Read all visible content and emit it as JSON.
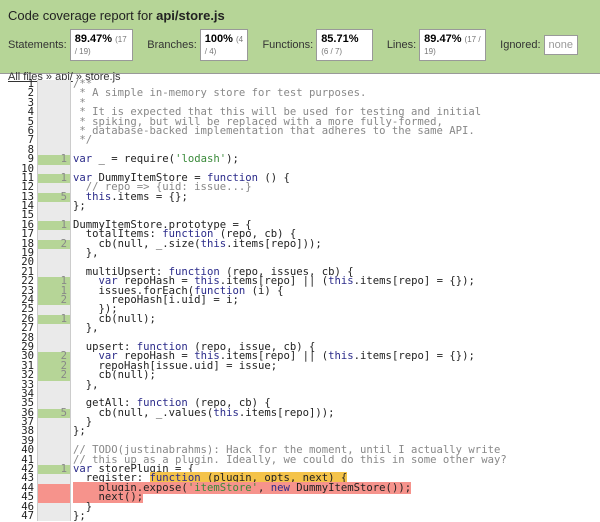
{
  "header": {
    "title_prefix": "Code coverage report for ",
    "title_file": "api/store.js",
    "stats": [
      {
        "label": "Statements:",
        "pct": "89.47%",
        "frac": "(17 / 19)"
      },
      {
        "label": "Branches:",
        "pct": "100%",
        "frac": "(4 / 4)"
      },
      {
        "label": "Functions:",
        "pct": "85.71%",
        "frac": "(6 / 7)"
      },
      {
        "label": "Lines:",
        "pct": "89.47%",
        "frac": "(17 / 19)"
      }
    ],
    "ignored_label": "Ignored:",
    "ignored_value": "none",
    "breadcrumb": {
      "all_files": "All files",
      "sep1": " » ",
      "dir": "api/",
      "sep2": " » ",
      "file": "store.js"
    }
  },
  "colors": {
    "covered": "#b6d597",
    "uncovered": "#f6938c",
    "uncovered_function": "#f4c34a"
  },
  "lines": [
    {
      "n": "1",
      "c": "",
      "s": "",
      "t": "/**"
    },
    {
      "n": "2",
      "c": "",
      "s": "",
      "t": " * A simple in-memory store for test purposes."
    },
    {
      "n": "3",
      "c": "",
      "s": "",
      "t": " *"
    },
    {
      "n": "4",
      "c": "",
      "s": "",
      "t": " * It is expected that this will be used for testing and initial"
    },
    {
      "n": "5",
      "c": "",
      "s": "",
      "t": " * spiking, but will be replaced with a more fully-formed,"
    },
    {
      "n": "6",
      "c": "",
      "s": "",
      "t": " * database-backed implementation that adheres to the same API."
    },
    {
      "n": "7",
      "c": "",
      "s": "",
      "t": " */"
    },
    {
      "n": "8",
      "c": "",
      "s": "",
      "t": ""
    },
    {
      "n": "9",
      "c": "1",
      "s": "yes",
      "t": "var _ = require('lodash');"
    },
    {
      "n": "10",
      "c": "",
      "s": "",
      "t": ""
    },
    {
      "n": "11",
      "c": "1",
      "s": "yes",
      "t": "var DummyItemStore = function () {"
    },
    {
      "n": "12",
      "c": "",
      "s": "",
      "t": "  // repo => {uid: issue...}"
    },
    {
      "n": "13",
      "c": "5",
      "s": "yes",
      "t": "  this.items = {};"
    },
    {
      "n": "14",
      "c": "",
      "s": "",
      "t": "};"
    },
    {
      "n": "15",
      "c": "",
      "s": "",
      "t": ""
    },
    {
      "n": "16",
      "c": "1",
      "s": "yes",
      "t": "DummyItemStore.prototype = {"
    },
    {
      "n": "17",
      "c": "",
      "s": "",
      "t": "  totalItems: function (repo, cb) {"
    },
    {
      "n": "18",
      "c": "2",
      "s": "yes",
      "t": "    cb(null, _.size(this.items[repo]));"
    },
    {
      "n": "19",
      "c": "",
      "s": "",
      "t": "  },"
    },
    {
      "n": "20",
      "c": "",
      "s": "",
      "t": ""
    },
    {
      "n": "21",
      "c": "",
      "s": "",
      "t": "  multiUpsert: function (repo, issues, cb) {"
    },
    {
      "n": "22",
      "c": "1",
      "s": "yes",
      "t": "    var repoHash = this.items[repo] || (this.items[repo] = {});"
    },
    {
      "n": "23",
      "c": "1",
      "s": "yes",
      "t": "    issues.forEach(function (i) {"
    },
    {
      "n": "24",
      "c": "2",
      "s": "yes",
      "t": "      repoHash[i.uid] = i;"
    },
    {
      "n": "25",
      "c": "",
      "s": "",
      "t": "    });"
    },
    {
      "n": "26",
      "c": "1",
      "s": "yes",
      "t": "    cb(null);"
    },
    {
      "n": "27",
      "c": "",
      "s": "",
      "t": "  },"
    },
    {
      "n": "28",
      "c": "",
      "s": "",
      "t": ""
    },
    {
      "n": "29",
      "c": "",
      "s": "",
      "t": "  upsert: function (repo, issue, cb) {"
    },
    {
      "n": "30",
      "c": "2",
      "s": "yes",
      "t": "    var repoHash = this.items[repo] || (this.items[repo] = {});"
    },
    {
      "n": "31",
      "c": "2",
      "s": "yes",
      "t": "    repoHash[issue.uid] = issue;"
    },
    {
      "n": "32",
      "c": "2",
      "s": "yes",
      "t": "    cb(null);"
    },
    {
      "n": "33",
      "c": "",
      "s": "",
      "t": "  },"
    },
    {
      "n": "34",
      "c": "",
      "s": "",
      "t": ""
    },
    {
      "n": "35",
      "c": "",
      "s": "",
      "t": "  getAll: function (repo, cb) {"
    },
    {
      "n": "36",
      "c": "5",
      "s": "yes",
      "t": "    cb(null, _.values(this.items[repo]));"
    },
    {
      "n": "37",
      "c": "",
      "s": "",
      "t": "  }"
    },
    {
      "n": "38",
      "c": "",
      "s": "",
      "t": "};"
    },
    {
      "n": "39",
      "c": "",
      "s": "",
      "t": ""
    },
    {
      "n": "40",
      "c": "",
      "s": "",
      "t": "// TODO(justinabrahms): Hack for the moment, until I actually write"
    },
    {
      "n": "41",
      "c": "",
      "s": "",
      "t": "// this up as a plugin. Ideally, we could do this in some other way?"
    },
    {
      "n": "42",
      "c": "1",
      "s": "yes",
      "t": "var storePlugin = {"
    },
    {
      "n": "43",
      "c": "",
      "s": "fn",
      "t": "  register: ",
      "h": "function (plugin, opts, next) {"
    },
    {
      "n": "44",
      "c": "",
      "s": "no",
      "t": "    plugin.expose('itemStore', new DummyItemStore());"
    },
    {
      "n": "45",
      "c": "",
      "s": "no",
      "t": "    next();"
    },
    {
      "n": "46",
      "c": "",
      "s": "",
      "t": "  }"
    },
    {
      "n": "47",
      "c": "",
      "s": "",
      "t": "};"
    }
  ]
}
